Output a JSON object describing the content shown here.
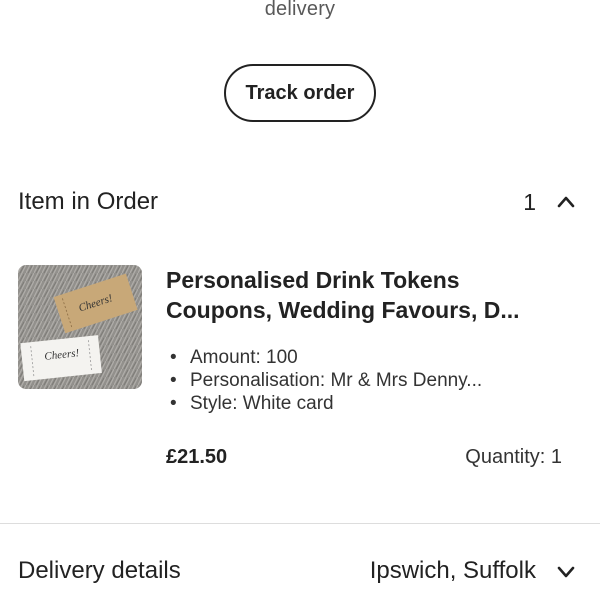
{
  "status": {
    "delivery_text": "delivery"
  },
  "actions": {
    "track_order_label": "Track order"
  },
  "items_section": {
    "title": "Item in Order",
    "count": "1",
    "toggle_icon": "chevron-up-icon",
    "expanded": true
  },
  "item": {
    "image_icon": "product-photo",
    "title_line1": "Personalised Drink Tokens",
    "title_line2": "Coupons, Wedding Favours, D...",
    "attributes": [
      "Amount: 100",
      "Personalisation: Mr & Mrs Denny...",
      "Style: White card"
    ],
    "bullet": "•",
    "price": "£21.50",
    "quantity": "Quantity: 1"
  },
  "delivery_details": {
    "label": "Delivery details",
    "location": "Ipswich, Suffolk",
    "toggle_icon": "chevron-down-icon"
  },
  "colors": {
    "text": "#222222",
    "muted": "#595959",
    "divider": "#dddddd"
  }
}
